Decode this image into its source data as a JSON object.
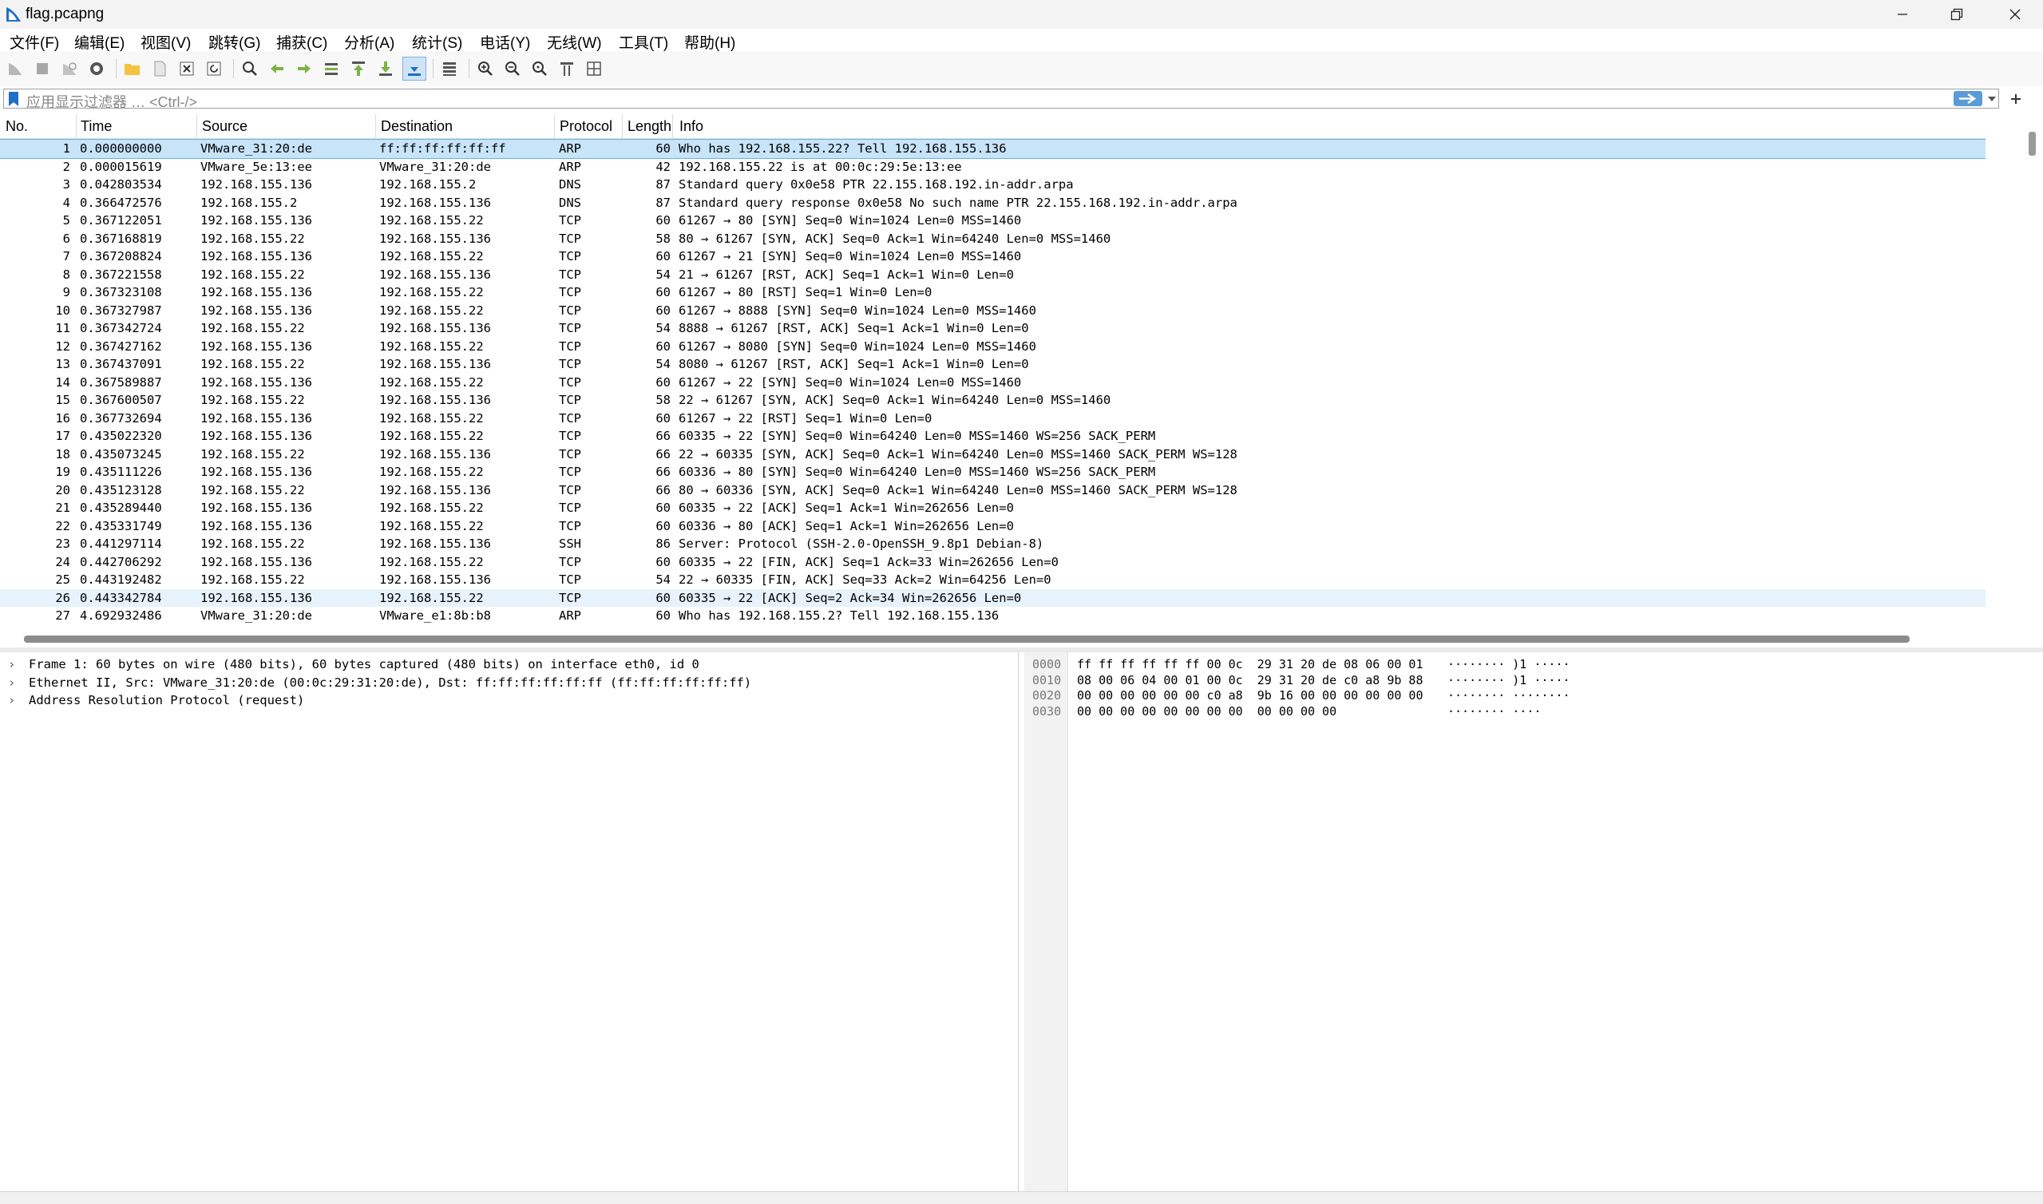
{
  "window": {
    "title": "flag.pcapng"
  },
  "menu": [
    "文件(F)",
    "编辑(E)",
    "视图(V)",
    "跳转(G)",
    "捕获(C)",
    "分析(A)",
    "统计(S)",
    "电话(Y)",
    "无线(W)",
    "工具(T)",
    "帮助(H)"
  ],
  "filter": {
    "placeholder": "应用显示过滤器 … <Ctrl-/>"
  },
  "columns": [
    "No.",
    "Time",
    "Source",
    "Destination",
    "Protocol",
    "Length",
    "Info"
  ],
  "packets": [
    [
      "1",
      "0.000000000",
      "VMware_31:20:de",
      "ff:ff:ff:ff:ff:ff",
      "ARP",
      "60",
      "Who has 192.168.155.22? Tell 192.168.155.136"
    ],
    [
      "2",
      "0.000015619",
      "VMware_5e:13:ee",
      "VMware_31:20:de",
      "ARP",
      "42",
      "192.168.155.22 is at 00:0c:29:5e:13:ee"
    ],
    [
      "3",
      "0.042803534",
      "192.168.155.136",
      "192.168.155.2",
      "DNS",
      "87",
      "Standard query 0x0e58 PTR 22.155.168.192.in-addr.arpa"
    ],
    [
      "4",
      "0.366472576",
      "192.168.155.2",
      "192.168.155.136",
      "DNS",
      "87",
      "Standard query response 0x0e58 No such name PTR 22.155.168.192.in-addr.arpa"
    ],
    [
      "5",
      "0.367122051",
      "192.168.155.136",
      "192.168.155.22",
      "TCP",
      "60",
      "61267 → 80 [SYN] Seq=0 Win=1024 Len=0 MSS=1460"
    ],
    [
      "6",
      "0.367168819",
      "192.168.155.22",
      "192.168.155.136",
      "TCP",
      "58",
      "80 → 61267 [SYN, ACK] Seq=0 Ack=1 Win=64240 Len=0 MSS=1460"
    ],
    [
      "7",
      "0.367208824",
      "192.168.155.136",
      "192.168.155.22",
      "TCP",
      "60",
      "61267 → 21 [SYN] Seq=0 Win=1024 Len=0 MSS=1460"
    ],
    [
      "8",
      "0.367221558",
      "192.168.155.22",
      "192.168.155.136",
      "TCP",
      "54",
      "21 → 61267 [RST, ACK] Seq=1 Ack=1 Win=0 Len=0"
    ],
    [
      "9",
      "0.367323108",
      "192.168.155.136",
      "192.168.155.22",
      "TCP",
      "60",
      "61267 → 80 [RST] Seq=1 Win=0 Len=0"
    ],
    [
      "10",
      "0.367327987",
      "192.168.155.136",
      "192.168.155.22",
      "TCP",
      "60",
      "61267 → 8888 [SYN] Seq=0 Win=1024 Len=0 MSS=1460"
    ],
    [
      "11",
      "0.367342724",
      "192.168.155.22",
      "192.168.155.136",
      "TCP",
      "54",
      "8888 → 61267 [RST, ACK] Seq=1 Ack=1 Win=0 Len=0"
    ],
    [
      "12",
      "0.367427162",
      "192.168.155.136",
      "192.168.155.22",
      "TCP",
      "60",
      "61267 → 8080 [SYN] Seq=0 Win=1024 Len=0 MSS=1460"
    ],
    [
      "13",
      "0.367437091",
      "192.168.155.22",
      "192.168.155.136",
      "TCP",
      "54",
      "8080 → 61267 [RST, ACK] Seq=1 Ack=1 Win=0 Len=0"
    ],
    [
      "14",
      "0.367589887",
      "192.168.155.136",
      "192.168.155.22",
      "TCP",
      "60",
      "61267 → 22 [SYN] Seq=0 Win=1024 Len=0 MSS=1460"
    ],
    [
      "15",
      "0.367600507",
      "192.168.155.22",
      "192.168.155.136",
      "TCP",
      "58",
      "22 → 61267 [SYN, ACK] Seq=0 Ack=1 Win=64240 Len=0 MSS=1460"
    ],
    [
      "16",
      "0.367732694",
      "192.168.155.136",
      "192.168.155.22",
      "TCP",
      "60",
      "61267 → 22 [RST] Seq=1 Win=0 Len=0"
    ],
    [
      "17",
      "0.435022320",
      "192.168.155.136",
      "192.168.155.22",
      "TCP",
      "66",
      "60335 → 22 [SYN] Seq=0 Win=64240 Len=0 MSS=1460 WS=256 SACK_PERM"
    ],
    [
      "18",
      "0.435073245",
      "192.168.155.22",
      "192.168.155.136",
      "TCP",
      "66",
      "22 → 60335 [SYN, ACK] Seq=0 Ack=1 Win=64240 Len=0 MSS=1460 SACK_PERM WS=128"
    ],
    [
      "19",
      "0.435111226",
      "192.168.155.136",
      "192.168.155.22",
      "TCP",
      "66",
      "60336 → 80 [SYN] Seq=0 Win=64240 Len=0 MSS=1460 WS=256 SACK_PERM"
    ],
    [
      "20",
      "0.435123128",
      "192.168.155.22",
      "192.168.155.136",
      "TCP",
      "66",
      "80 → 60336 [SYN, ACK] Seq=0 Ack=1 Win=64240 Len=0 MSS=1460 SACK_PERM WS=128"
    ],
    [
      "21",
      "0.435289440",
      "192.168.155.136",
      "192.168.155.22",
      "TCP",
      "60",
      "60335 → 22 [ACK] Seq=1 Ack=1 Win=262656 Len=0"
    ],
    [
      "22",
      "0.435331749",
      "192.168.155.136",
      "192.168.155.22",
      "TCP",
      "60",
      "60336 → 80 [ACK] Seq=1 Ack=1 Win=262656 Len=0"
    ],
    [
      "23",
      "0.441297114",
      "192.168.155.22",
      "192.168.155.136",
      "SSH",
      "86",
      "Server: Protocol (SSH-2.0-OpenSSH_9.8p1 Debian-8)"
    ],
    [
      "24",
      "0.442706292",
      "192.168.155.136",
      "192.168.155.22",
      "TCP",
      "60",
      "60335 → 22 [FIN, ACK] Seq=1 Ack=33 Win=262656 Len=0"
    ],
    [
      "25",
      "0.443192482",
      "192.168.155.22",
      "192.168.155.136",
      "TCP",
      "54",
      "22 → 60335 [FIN, ACK] Seq=33 Ack=2 Win=64256 Len=0"
    ],
    [
      "26",
      "0.443342784",
      "192.168.155.136",
      "192.168.155.22",
      "TCP",
      "60",
      "60335 → 22 [ACK] Seq=2 Ack=34 Win=262656 Len=0"
    ],
    [
      "27",
      "4.692932486",
      "VMware_31:20:de",
      "VMware_e1:8b:b8",
      "ARP",
      "60",
      "Who has 192.168.155.2? Tell 192.168.155.136"
    ]
  ],
  "selected_packet": 1,
  "details": [
    "Frame 1: 60 bytes on wire (480 bits), 60 bytes captured (480 bits) on interface eth0, id 0",
    "Ethernet II, Src: VMware_31:20:de (00:0c:29:31:20:de), Dst: ff:ff:ff:ff:ff:ff (ff:ff:ff:ff:ff:ff)",
    "Address Resolution Protocol (request)"
  ],
  "bytes": [
    {
      "offset": "0000",
      "hex": "ff ff ff ff ff ff 00 0c  29 31 20 de 08 06 00 01",
      "ascii": "········ )1 ·····"
    },
    {
      "offset": "0010",
      "hex": "08 00 06 04 00 01 00 0c  29 31 20 de c0 a8 9b 88",
      "ascii": "········ )1 ·····"
    },
    {
      "offset": "0020",
      "hex": "00 00 00 00 00 00 c0 a8  9b 16 00 00 00 00 00 00",
      "ascii": "········ ········"
    },
    {
      "offset": "0030",
      "hex": "00 00 00 00 00 00 00 00  00 00 00 00",
      "ascii": "········ ····"
    }
  ],
  "colors": {
    "selected_row": "#c7e4f8",
    "accent": "#1e6fc7"
  }
}
